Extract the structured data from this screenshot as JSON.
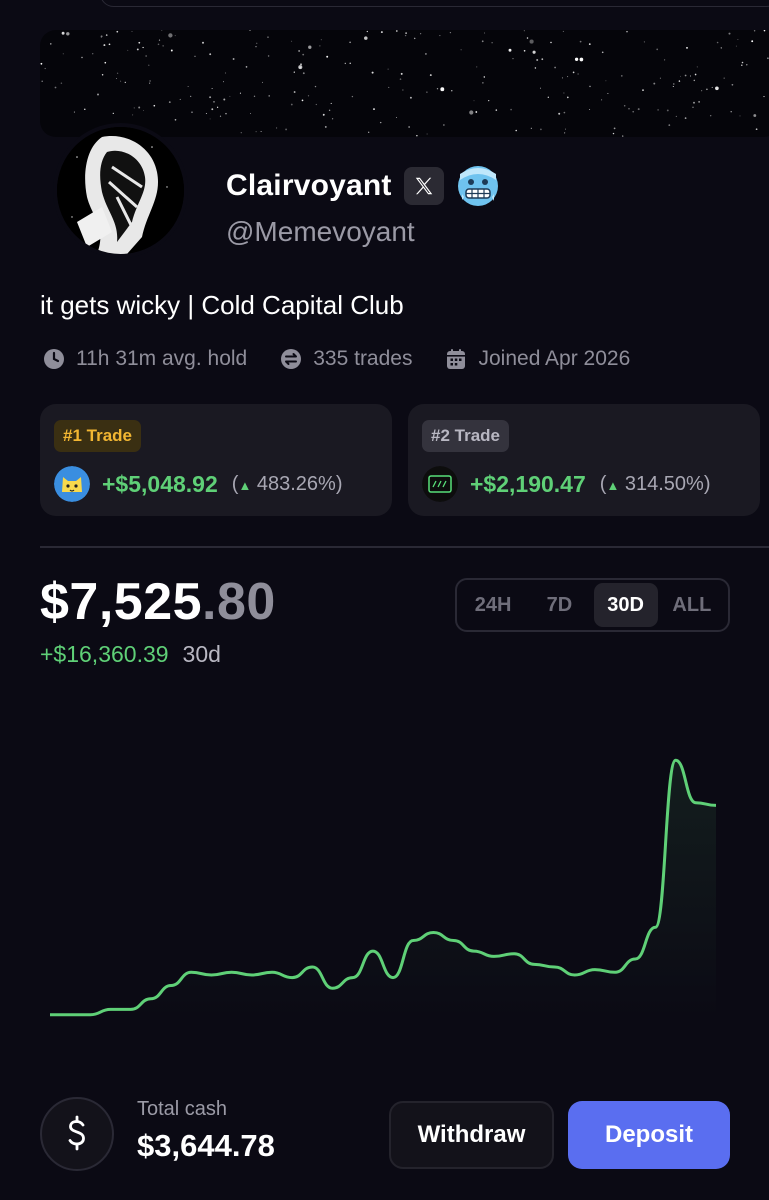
{
  "profile": {
    "name": "Clairvoyant",
    "handle": "@Memevoyant",
    "bio": "it gets wicky | Cold Capital Club",
    "x_badge_icon": "x-logo-icon",
    "emoji_badge_icon": "cold-face-emoji-icon"
  },
  "stats": [
    {
      "icon": "clock-icon",
      "label": "11h 31m avg. hold"
    },
    {
      "icon": "swap-icon",
      "label": "335 trades"
    },
    {
      "icon": "calendar-icon",
      "label": "Joined Apr 2026"
    }
  ],
  "top_trades": [
    {
      "rank_label": "#1 Trade",
      "icon": "cat-token-icon",
      "amount": "+$5,048.92",
      "pct_prefix": "(",
      "pct": "483.26%)"
    },
    {
      "rank_label": "#2 Trade",
      "icon": "terminal-token-icon",
      "amount": "+$2,190.47",
      "pct_prefix": "(",
      "pct": "314.50%)"
    }
  ],
  "portfolio": {
    "value_whole": "$7,525",
    "value_cents": ".80",
    "change": "+$16,360.39",
    "change_period": "30d"
  },
  "ranges": {
    "options": [
      "24H",
      "7D",
      "30D",
      "ALL"
    ],
    "selected": "30D"
  },
  "chart_data": {
    "type": "line",
    "series": [
      {
        "values": [
          0.02,
          0.02,
          0.02,
          0.04,
          0.04,
          0.08,
          0.13,
          0.18,
          0.17,
          0.18,
          0.17,
          0.18,
          0.16,
          0.2,
          0.12,
          0.16,
          0.26,
          0.16,
          0.3,
          0.33,
          0.3,
          0.26,
          0.24,
          0.25,
          0.21,
          0.2,
          0.17,
          0.19,
          0.18,
          0.23,
          0.35,
          0.98,
          0.82,
          0.81
        ]
      }
    ],
    "line_color": "#5fd077",
    "grid": false
  },
  "cash": {
    "label": "Total cash",
    "value": "$3,644.78",
    "icon": "dollar-icon"
  },
  "actions": {
    "withdraw": "Withdraw",
    "deposit": "Deposit"
  },
  "colors": {
    "background": "#0b0a14",
    "positive": "#5fd077",
    "accent": "#5a6ef0",
    "gold": "#f2b632"
  }
}
